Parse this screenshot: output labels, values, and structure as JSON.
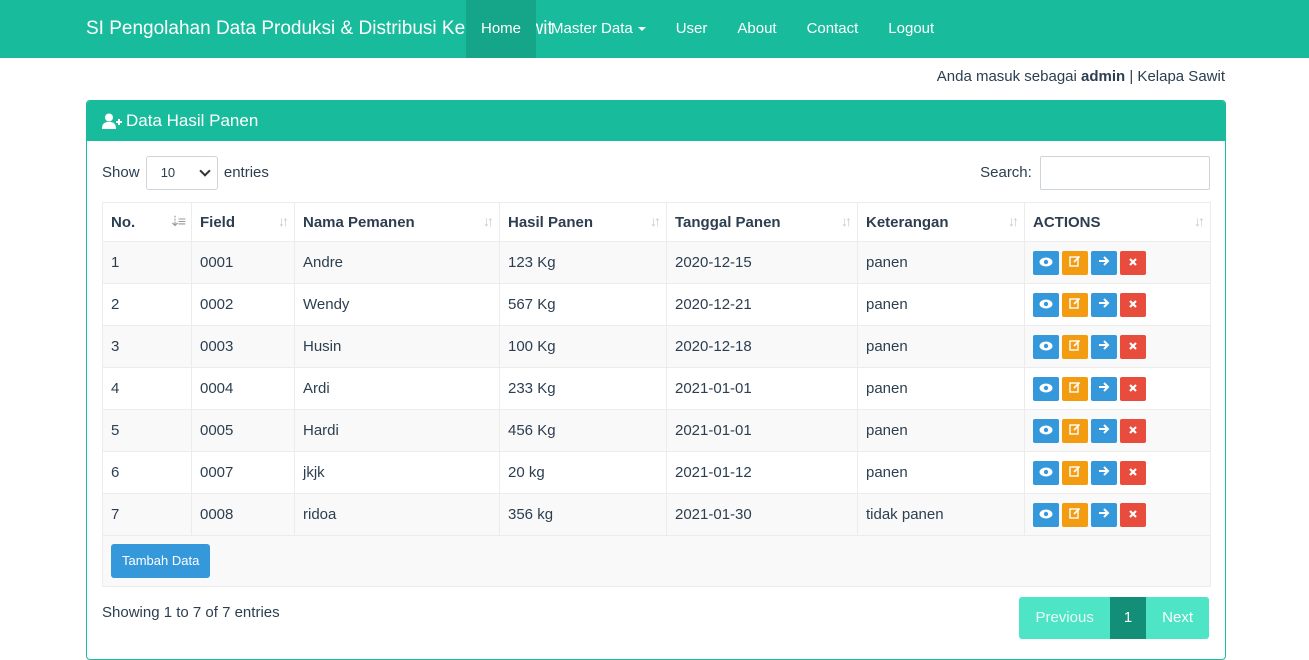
{
  "navbar": {
    "brand": "SI Pengolahan Data Produksi & Distribusi Kelapa Sawit",
    "items": [
      {
        "label": "Home",
        "active": true
      },
      {
        "label": "Master Data",
        "dropdown": true
      },
      {
        "label": "User"
      },
      {
        "label": "About"
      },
      {
        "label": "Contact"
      },
      {
        "label": "Logout"
      }
    ]
  },
  "userinfo": {
    "prefix": "Anda masuk sebagai ",
    "username": "admin",
    "suffix": " | Kelapa Sawit"
  },
  "panel": {
    "title": "Data Hasil Panen",
    "icon": "user-plus-icon"
  },
  "controls": {
    "show_label": "Show",
    "entries_value": "10",
    "entries_label": "entries",
    "search_label": "Search:"
  },
  "table": {
    "columns": [
      "No.",
      "Field",
      "Nama Pemanen",
      "Hasil Panen",
      "Tanggal Panen",
      "Keterangan",
      "ACTIONS"
    ],
    "rows": [
      [
        "1",
        "0001",
        "Andre",
        "123 Kg",
        "2020-12-15",
        "panen"
      ],
      [
        "2",
        "0002",
        "Wendy",
        "567 Kg",
        "2020-12-21",
        "panen"
      ],
      [
        "3",
        "0003",
        "Husin",
        "100 Kg",
        "2020-12-18",
        "panen"
      ],
      [
        "4",
        "0004",
        "Ardi",
        "233 Kg",
        "2021-01-01",
        "panen"
      ],
      [
        "5",
        "0005",
        "Hardi",
        "456 Kg",
        "2021-01-01",
        "panen"
      ],
      [
        "6",
        "0007",
        "jkjk",
        "20 kg",
        "2021-01-12",
        "panen"
      ],
      [
        "7",
        "0008",
        "ridoa",
        "356 kg",
        "2021-01-30",
        "tidak panen"
      ]
    ],
    "actions": [
      "view-icon",
      "edit-icon",
      "arrow-right-icon",
      "close-icon"
    ],
    "add_button": "Tambah Data"
  },
  "footer": {
    "info": "Showing 1 to 7 of 7 entries",
    "pagination": {
      "previous": "Previous",
      "current": "1",
      "next": "Next"
    }
  },
  "colors": {
    "primary": "#18bc9c",
    "info": "#3498db",
    "warning": "#f39c12",
    "danger": "#e74c3c"
  }
}
